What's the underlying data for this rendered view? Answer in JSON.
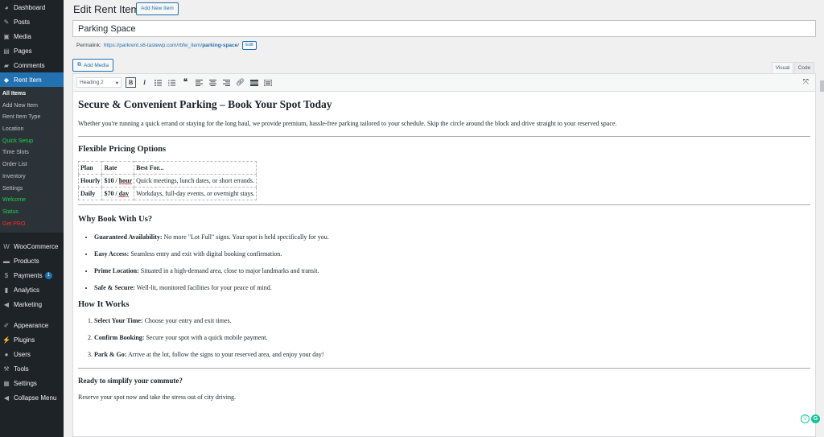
{
  "sidebar": {
    "top": [
      {
        "label": "Dashboard",
        "icon": "dashboard-icon",
        "glyph": "◕"
      },
      {
        "label": "Posts",
        "icon": "pin-icon",
        "glyph": "✎"
      },
      {
        "label": "Media",
        "icon": "media-icon",
        "glyph": "▣"
      },
      {
        "label": "Pages",
        "icon": "pages-icon",
        "glyph": "▤"
      },
      {
        "label": "Comments",
        "icon": "comments-icon",
        "glyph": "▰"
      }
    ],
    "active": {
      "label": "Rent Item",
      "icon": "tag-icon",
      "glyph": "◆"
    },
    "submenu": [
      {
        "label": "All Items",
        "style": "current"
      },
      {
        "label": "Add New Item",
        "style": ""
      },
      {
        "label": "Rent Item Type",
        "style": ""
      },
      {
        "label": "Location",
        "style": ""
      },
      {
        "label": "Quick Setup",
        "style": "green"
      },
      {
        "label": "Time Slots",
        "style": ""
      },
      {
        "label": "Order List",
        "style": ""
      },
      {
        "label": "Inventory",
        "style": ""
      },
      {
        "label": "Settings",
        "style": ""
      },
      {
        "label": "Welcome",
        "style": "green"
      },
      {
        "label": "Status",
        "style": "green"
      },
      {
        "label": "Get PRO",
        "style": "red"
      }
    ],
    "commerce": [
      {
        "label": "WooCommerce",
        "icon": "woocommerce-icon",
        "glyph": "W"
      },
      {
        "label": "Products",
        "icon": "products-icon",
        "glyph": "▬"
      },
      {
        "label": "Payments",
        "icon": "payments-icon",
        "glyph": "$",
        "badge": "1"
      },
      {
        "label": "Analytics",
        "icon": "analytics-icon",
        "glyph": "▮"
      },
      {
        "label": "Marketing",
        "icon": "marketing-icon",
        "glyph": "◀"
      }
    ],
    "bottom": [
      {
        "label": "Appearance",
        "icon": "brush-icon",
        "glyph": "✐"
      },
      {
        "label": "Plugins",
        "icon": "plugins-icon",
        "glyph": "⚡"
      },
      {
        "label": "Users",
        "icon": "users-icon",
        "glyph": "●"
      },
      {
        "label": "Tools",
        "icon": "tools-icon",
        "glyph": "⚒"
      },
      {
        "label": "Settings",
        "icon": "settings-icon",
        "glyph": "▦"
      },
      {
        "label": "Collapse Menu",
        "icon": "collapse-icon",
        "glyph": "◀"
      }
    ]
  },
  "header": {
    "title": "Edit Rent Item",
    "add_new": "Add New Item"
  },
  "post": {
    "title_value": "Parking Space",
    "permalink_label": "Permalink:",
    "permalink_base": "https://parkrent.s6-tastewp.com/rbfw_item/",
    "permalink_slug": "parking-space",
    "permalink_end": "/",
    "edit_label": "Edit"
  },
  "editor": {
    "add_media": "Add Media",
    "tab_visual": "Visual",
    "tab_code": "Code",
    "format": "Heading 2"
  },
  "doc": {
    "h1": "Secure & Convenient Parking – Book Your Spot Today",
    "intro": "Whether you're running a quick errand or staying for the long haul, we provide premium, hassle-free parking tailored to your schedule. Skip the circle around the block and drive straight to your reserved space.",
    "pricing_heading": "Flexible Pricing Options",
    "table_headers": [
      "Plan",
      "Rate",
      "Best For..."
    ],
    "table_rows": [
      {
        "plan": "Hourly",
        "price": "$10",
        "sep": " / ",
        "unit": "hour",
        "best": "Quick meetings, lunch dates, or short errands."
      },
      {
        "plan": "Daily",
        "price": "$70",
        "sep": " / ",
        "unit": "day",
        "best": "Workdays, full-day events, or overnight stays."
      }
    ],
    "why_heading": "Why Book With Us?",
    "why_items": [
      {
        "b": "Guaranteed Availability:",
        "t": " No more \"Lot Full\" signs. Your spot is held specifically for you."
      },
      {
        "b": "Easy Access:",
        "t": " Seamless entry and exit with digital booking confirmation."
      },
      {
        "b": "Prime Location:",
        "t": " Situated in a high-demand area, close to major landmarks and transit."
      },
      {
        "b": "Safe & Secure:",
        "t": " Well-lit, monitored facilities for your peace of mind."
      }
    ],
    "how_heading": "How It Works",
    "how_items": [
      {
        "b": "Select Your Time:",
        "t": " Choose your entry and exit times."
      },
      {
        "b": "Confirm Booking:",
        "t": " Secure your spot with a quick mobile payment."
      },
      {
        "b": "Park & Go:",
        "t": " Arrive at the lot, follow the signs to your reserved area, and enjoy your day!"
      }
    ],
    "ready_heading": "Ready to simplify your commute?",
    "ready_text": "Reserve your spot now and take the stress out of city driving."
  },
  "colors": {
    "sidebar_bg": "#1d2327",
    "accent": "#2271b1",
    "green": "#1ed14b",
    "red": "#ff2a2a",
    "grammarly": "#15c39a"
  }
}
